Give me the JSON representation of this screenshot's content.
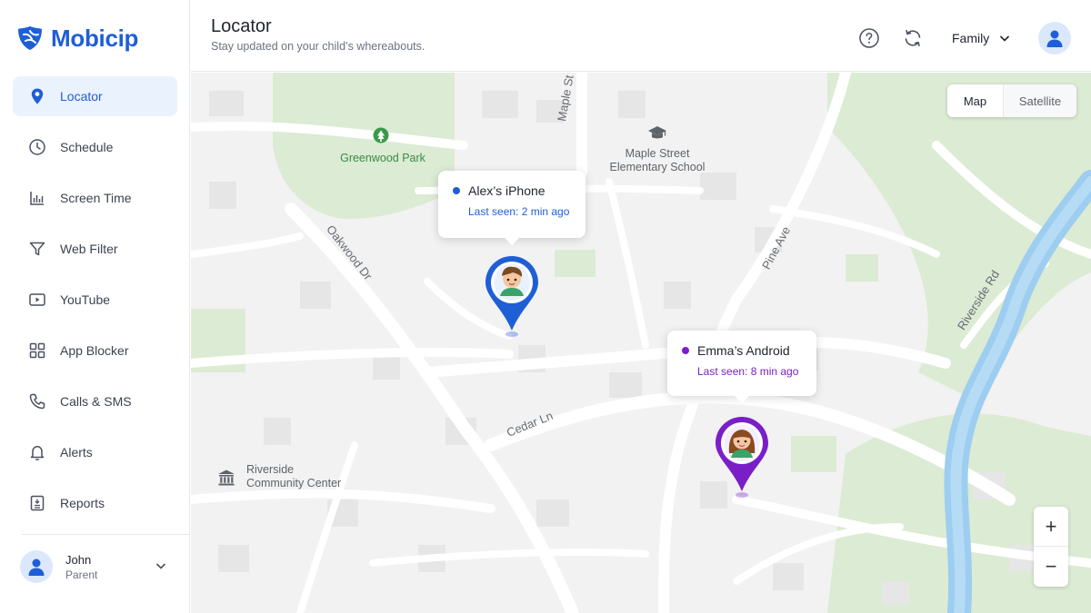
{
  "brand": {
    "name": "Mobicip",
    "color": "#1f5fd6"
  },
  "nav": [
    {
      "label": "Locator",
      "icon": "location-pin-icon",
      "active": true
    },
    {
      "label": "Schedule",
      "icon": "clock-icon"
    },
    {
      "label": "Screen Time",
      "icon": "bar-chart-icon"
    },
    {
      "label": "Web Filter",
      "icon": "filter-icon"
    },
    {
      "label": "YouTube",
      "icon": "play-icon"
    },
    {
      "label": "App Blocker",
      "icon": "apps-grid-icon"
    },
    {
      "label": "Calls & SMS",
      "icon": "phone-icon"
    },
    {
      "label": "Alerts",
      "icon": "bell-icon"
    },
    {
      "label": "Reports",
      "icon": "report-icon"
    }
  ],
  "user": {
    "name": "John",
    "role": "Parent"
  },
  "header": {
    "title": "Locator",
    "subtitle": "Stay updated on your child’s whereabouts.",
    "family_label": "Family"
  },
  "map": {
    "toggle": {
      "map": "Map",
      "satellite": "Satellite",
      "selected": "Map"
    },
    "places": {
      "park": "Greenwood Park",
      "school_line1": "Maple Street",
      "school_line2": "Elementary School",
      "center_line1": "Riverside",
      "center_line2": "Community Center"
    },
    "streets": {
      "maple": "Maple St",
      "oakwood": "Oakwood Dr",
      "pine": "Pine Ave",
      "riverside": "Riverside Rd",
      "cedar": "Cedar Ln"
    },
    "devices": [
      {
        "name": "Alex’s iPhone",
        "last_seen": "Last seen: 2 min ago",
        "color": "#1f5fd6"
      },
      {
        "name": "Emma’s Android",
        "last_seen": "Last seen: 8 min ago",
        "color": "#7a1fc7"
      }
    ],
    "zoom": {
      "in": "+",
      "out": "−"
    },
    "colors": {
      "land": "#f2f2f2",
      "road": "#ffffff",
      "park": "#dcebd3",
      "water": "#9dcdf0"
    }
  }
}
